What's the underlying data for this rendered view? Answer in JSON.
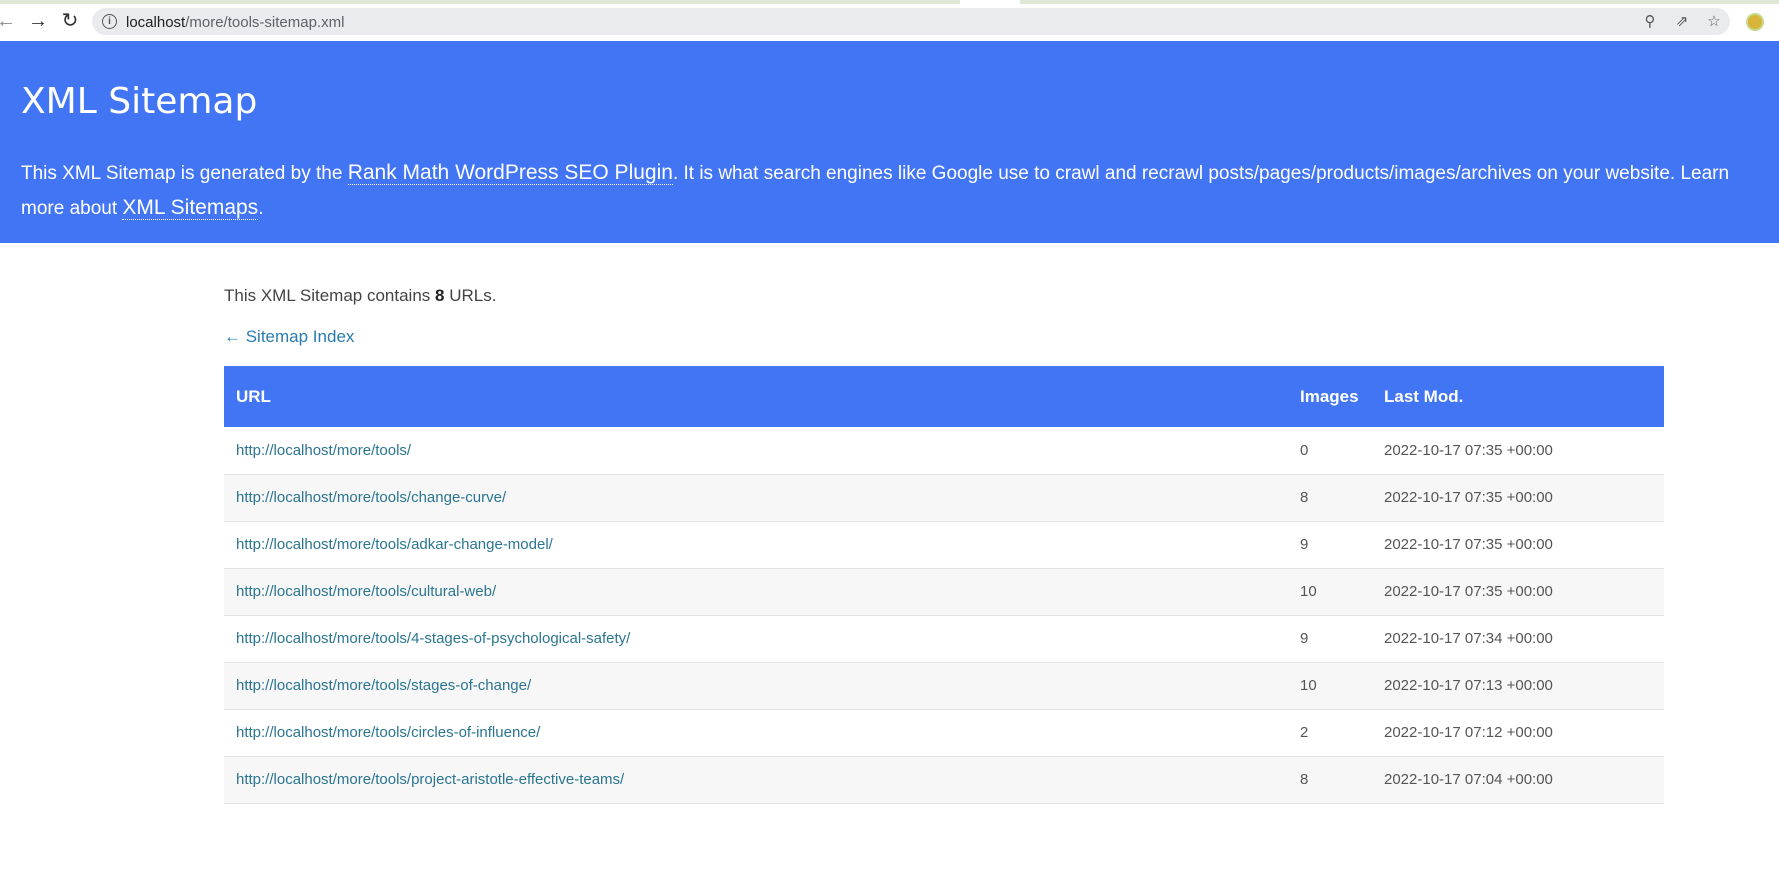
{
  "browser": {
    "url_host": "localhost",
    "url_path": "/more/tools-sitemap.xml"
  },
  "header": {
    "title": "XML Sitemap",
    "desc_pre": "This XML Sitemap is generated by the ",
    "plugin_link": "Rank Math WordPress SEO Plugin",
    "desc_mid": ". It is what search engines like Google use to crawl and recrawl posts/pages/products/images/archives on your website. Learn more about ",
    "sitemaps_link": "XML Sitemaps",
    "desc_post": "."
  },
  "summary": {
    "pre": "This XML Sitemap contains ",
    "count": "8",
    "post": " URLs."
  },
  "back_link": "← Sitemap Index",
  "table": {
    "headers": [
      "URL",
      "Images",
      "Last Mod."
    ],
    "rows": [
      {
        "url": "http://localhost/more/tools/",
        "images": "0",
        "lastmod": "2022-10-17 07:35 +00:00"
      },
      {
        "url": "http://localhost/more/tools/change-curve/",
        "images": "8",
        "lastmod": "2022-10-17 07:35 +00:00"
      },
      {
        "url": "http://localhost/more/tools/adkar-change-model/",
        "images": "9",
        "lastmod": "2022-10-17 07:35 +00:00"
      },
      {
        "url": "http://localhost/more/tools/cultural-web/",
        "images": "10",
        "lastmod": "2022-10-17 07:35 +00:00"
      },
      {
        "url": "http://localhost/more/tools/4-stages-of-psychological-safety/",
        "images": "9",
        "lastmod": "2022-10-17 07:34 +00:00"
      },
      {
        "url": "http://localhost/more/tools/stages-of-change/",
        "images": "10",
        "lastmod": "2022-10-17 07:13 +00:00"
      },
      {
        "url": "http://localhost/more/tools/circles-of-influence/",
        "images": "2",
        "lastmod": "2022-10-17 07:12 +00:00"
      },
      {
        "url": "http://localhost/more/tools/project-aristotle-effective-teams/",
        "images": "8",
        "lastmod": "2022-10-17 07:04 +00:00"
      }
    ]
  },
  "colors": {
    "header_bg": "#4275f4",
    "link": "#2a7590"
  },
  "icons": {
    "back": "arrow-left-icon",
    "forward": "arrow-right-icon",
    "reload": "reload-icon",
    "info": "info-icon",
    "zoom": "zoom-icon",
    "share": "share-icon",
    "bookmark": "star-icon",
    "profile": "profile-icon"
  }
}
